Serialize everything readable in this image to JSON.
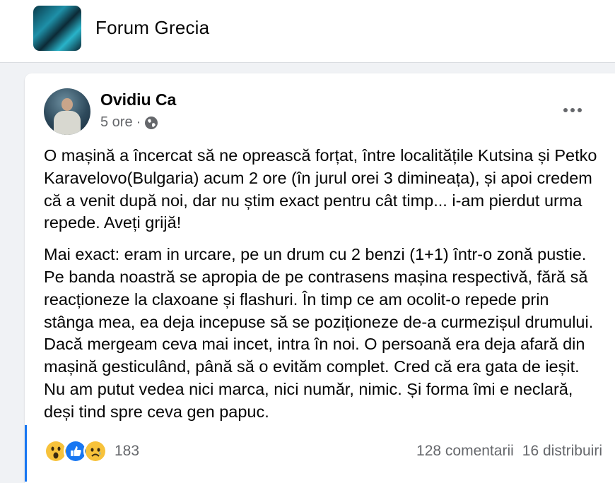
{
  "group": {
    "name": "Forum Grecia"
  },
  "post": {
    "author": "Ovidiu Ca",
    "time": "5 ore",
    "separator": "·",
    "visibility_icon": "globe-icon",
    "paragraphs": [
      "O mașină a încercat să ne oprească forțat, între localitățile Kutsina și Petko Karavelovo(Bulgaria) acum 2 ore (în jurul orei 3 dimineața), și apoi credem că a venit după noi, dar nu știm exact pentru cât timp... i-am pierdut urma repede. Aveți grijă!",
      "Mai exact: eram in urcare, pe un drum cu 2 benzi (1+1) într-o zonă pustie. Pe banda noastră se apropia de pe contrasens mașina respectivă, fără să reacționeze la claxoane și flashuri. În timp ce am ocolit-o repede prin stânga mea, ea deja incepuse să se poziționeze de-a curmezișul drumului. Dacă mergeam ceva mai incet, intra în noi. O persoană era deja afară din mașină gesticulând, până să o evităm complet. Cred că era gata de ieșit. Nu am putut vedea nici marca, nici număr, nimic. Și forma îmi e neclară, deși tind spre ceva gen papuc."
    ],
    "reactions": {
      "icons": [
        "wow-reaction-icon",
        "like-reaction-icon",
        "sad-reaction-icon"
      ],
      "count": "183"
    },
    "comments": "128 comentarii",
    "shares": "16 distribuiri"
  },
  "colors": {
    "accent": "#1877f2",
    "text": "#050505",
    "muted": "#65676b",
    "background": "#f0f2f5"
  }
}
